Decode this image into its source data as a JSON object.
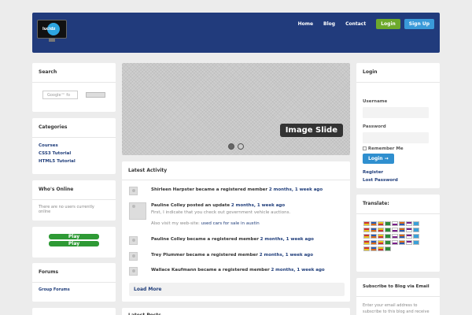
{
  "header": {
    "logo_text": "lucidz",
    "nav": [
      "Home",
      "Blog",
      "Contact"
    ],
    "login": "Login",
    "signup": "Sign Up"
  },
  "search": {
    "title": "Search",
    "placeholder": "Google™ fo"
  },
  "categories": {
    "title": "Categories",
    "items": [
      "Courses",
      "CSS3 Tutorial",
      "HTML5 Tutorial"
    ]
  },
  "online": {
    "title": "Who's Online",
    "text_line1": "There are no users currently",
    "text_line2": "online"
  },
  "play": {
    "label": "Play"
  },
  "forums": {
    "title": "Forums",
    "item": "Group Forums"
  },
  "slider": {
    "caption": "Image Slide"
  },
  "activity": {
    "title": "Latest Activity",
    "items": [
      {
        "user": "Shirleen Harpster",
        "action": "became a registered member",
        "time": "2 months, 1 week ago"
      },
      {
        "user": "Pauline Colley",
        "action": "posted an update",
        "time": "2 months, 1 week ago",
        "excerpt": "First, I indicate that you check out government vehicle auctions.",
        "also_prefix": "Also visit my web-site: ",
        "also_link": "used cars for sale in austin"
      },
      {
        "user": "Pauline Colley",
        "action": "became a registered member",
        "time": "2 months, 1 week ago"
      },
      {
        "user": "Trey Plummer",
        "action": "became a registered member",
        "time": "2 months, 1 week ago"
      },
      {
        "user": "Wallace Kaufmann",
        "action": "became a registered member",
        "time": "2 months, 1 week ago"
      }
    ],
    "load_more": "Load More"
  },
  "next_section": "Latest Posts",
  "login_box": {
    "title": "Login",
    "username_label": "Username",
    "password_label": "Password",
    "remember": "Remember Me",
    "button": "Login →",
    "register": "Register",
    "lost": "Lost Password"
  },
  "translate": {
    "title": "Translate:"
  },
  "subscribe": {
    "title": "Subscribe to Blog via Email",
    "text_line1": "Enter your email address to",
    "text_line2": "subscribe to this blog and receive"
  },
  "colors": {
    "header": "#213b7c",
    "login": "#6da92c",
    "signup": "#3a9ad9",
    "link": "#1f3d7a"
  }
}
